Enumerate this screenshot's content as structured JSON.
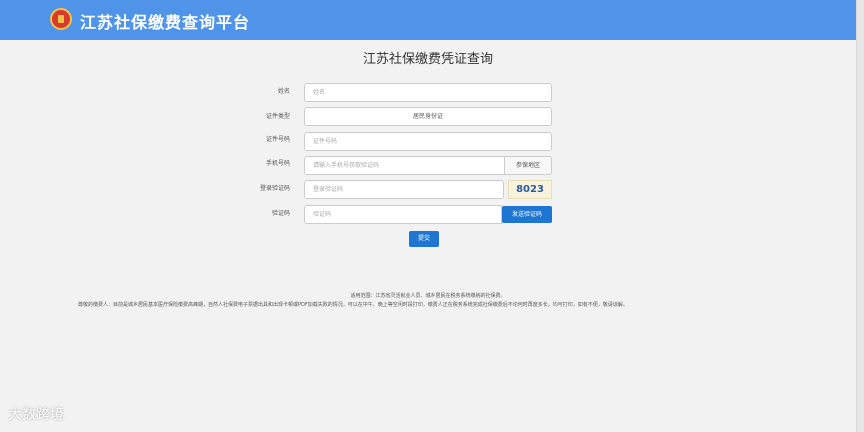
{
  "header": {
    "title": "江苏社保缴费查询平台"
  },
  "page_title": "江苏社保缴费凭证查询",
  "form": {
    "name": {
      "label": "姓名",
      "placeholder": "姓名"
    },
    "id_type": {
      "label": "证件类型",
      "value": "居民身份证"
    },
    "id_number": {
      "label": "证件号码",
      "placeholder": "证件号码"
    },
    "phone": {
      "label": "手机号码",
      "placeholder": "请输入手机号获取验证码",
      "addon": "参保地区"
    },
    "login_code": {
      "label": "登录验证码",
      "placeholder": "登录验证码",
      "captcha": "8023"
    },
    "sms_code": {
      "label": "验证码",
      "placeholder": "验证码",
      "send_button": "发送验证码"
    },
    "submit": "提交"
  },
  "notes": {
    "scope": "适用范围：江苏省灵活就业人员、城乡居民在税务系统缴纳的社保费。",
    "notice": "尊敬的缴费人：目前是城乡居民基本医疗保险缴费高峰期，自然人社保费电子票据出具和出现卡顿或PDF加载失败的情况，可以在中午、晚上等空闲时段打印，缴费人正在税务系统完成社保缴费后不论何时再度多长，均可打印。如有不便，敬请谅解。"
  },
  "watermark": "大数跨境"
}
